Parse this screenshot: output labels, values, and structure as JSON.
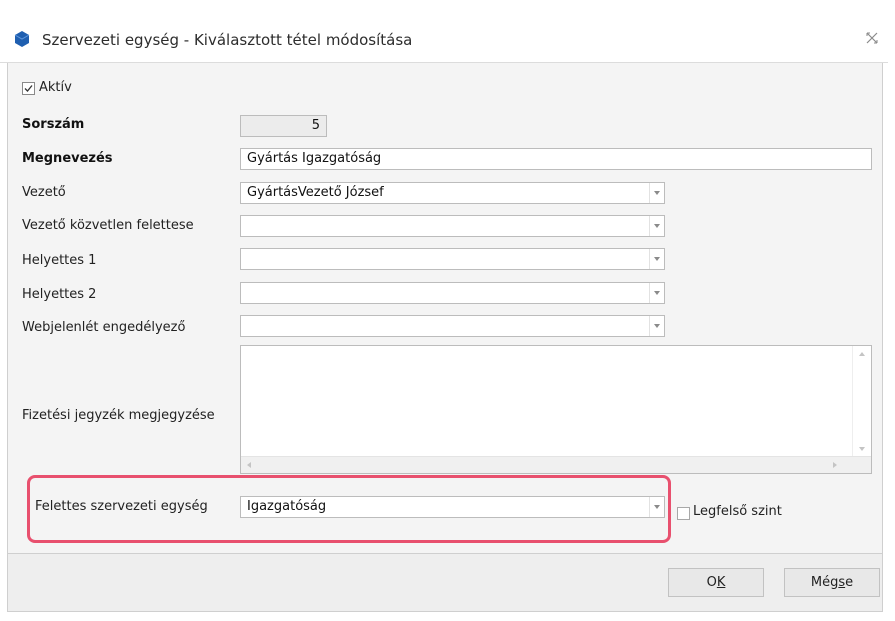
{
  "window": {
    "title": "Szervezeti egység - Kiválasztott tétel módosítása"
  },
  "form": {
    "active": {
      "label": "Aktív",
      "checked": true
    },
    "sorszam": {
      "label": "Sorszám",
      "value": "5"
    },
    "megnevezes": {
      "label": "Megnevezés",
      "value": "Gyártás Igazgatóság"
    },
    "vezeto": {
      "label": "Vezető",
      "value": "GyártásVezető József"
    },
    "vezeto_felettese": {
      "label": "Vezető közvetlen felettese",
      "value": ""
    },
    "helyettes1": {
      "label": "Helyettes 1",
      "value": ""
    },
    "helyettes2": {
      "label": "Helyettes 2",
      "value": ""
    },
    "webjelenlet": {
      "label": "Webjelenlét engedélyező",
      "value": ""
    },
    "fizetesi": {
      "label": "Fizetési jegyzék megjegyzése",
      "value": ""
    },
    "felettes": {
      "label": "Felettes szervezeti egység",
      "value": "Igazgatóság"
    },
    "legfelso": {
      "label": "Legfelső szint",
      "checked": false
    }
  },
  "buttons": {
    "ok": {
      "prefix": "O",
      "accel": "K",
      "suffix": ""
    },
    "megse": {
      "prefix": "Még",
      "accel": "s",
      "suffix": "e"
    }
  },
  "colors": {
    "highlight": "#e8506e",
    "icon": "#1f5fb0"
  }
}
